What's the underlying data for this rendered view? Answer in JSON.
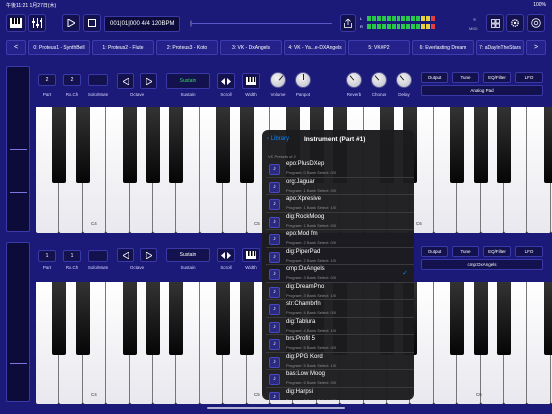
{
  "status": {
    "time": "午後11:21 1月27日(木)",
    "battery": "100%"
  },
  "toolbar": {
    "song_position": "001|01|000  4/4  120BPM",
    "midi_label": "MIDI",
    "meter_left": "L",
    "meter_right": "R"
  },
  "tabs": [
    "0: Proteus1 - SynthBell",
    "1: Proteus2 - Flute",
    "2: Proteus3 - Koto",
    "3: VK - DxAngels",
    "4: VK - Ya...e-DXAngels",
    "5: VK#P2",
    "6: Everlasting Dream",
    "7: aDayInTheStars"
  ],
  "tab_prev": "<",
  "tab_next": ">",
  "parts": [
    {
      "part": "2",
      "rxch": "2",
      "solo": "",
      "labels": {
        "part": "Part",
        "rxch": "Rx.Ch",
        "solo": "Solo/Mute",
        "octave": "Octave",
        "sustain": "Sustain",
        "scroll": "Scroll",
        "width": "Width",
        "volume": "Volume",
        "panpot": "Panpot",
        "reverb": "Reverb",
        "chorus": "Chorus",
        "delay": "Delay"
      },
      "sustain": "Sustain",
      "buttons": [
        "Output",
        "Tune",
        "EQ/Filter",
        "LFO"
      ],
      "preset": "Analog Pad",
      "key_labels": [
        "C4",
        "C5",
        "C6"
      ]
    },
    {
      "part": "1",
      "rxch": "1",
      "solo": "",
      "labels": {
        "part": "Part",
        "rxch": "Rx.Ch",
        "solo": "Solo/Mute",
        "octave": "Octave",
        "sustain": "Sustain",
        "scroll": "Scroll",
        "width": "Width"
      },
      "sustain": "Sustain",
      "buttons": [
        "Output",
        "Tune",
        "EQ/Filter",
        "LFO"
      ],
      "preset": "cmp:DxAngels",
      "key_labels": [
        "C4",
        "C5",
        "C6"
      ]
    }
  ],
  "popover": {
    "back": "Library",
    "title": "Instrument (Part #1)",
    "section": "VK Presets of 2",
    "items": [
      {
        "name": "epo:PlusDXep",
        "sub": "Program: 0  Bank Select: 0/0",
        "checked": false
      },
      {
        "name": "org:Jaguar",
        "sub": "Program: 1  Bank Select: 0/0",
        "checked": false
      },
      {
        "name": "apo:Xpresive",
        "sub": "Program: 1  Bank Select: 1/0",
        "checked": false
      },
      {
        "name": "dig:RockMoog",
        "sub": "Program: 1  Bank Select: 0/0",
        "checked": false
      },
      {
        "name": "epo:Mod fm",
        "sub": "Program: 2  Bank Select: 0/0",
        "checked": false
      },
      {
        "name": "dig:PiperPad",
        "sub": "Program: 2  Bank Select: 1/0",
        "checked": false
      },
      {
        "name": "cmp:DxAngels",
        "sub": "Program: 3  Bank Select: 0/0",
        "checked": true
      },
      {
        "name": "dig:DreamPno",
        "sub": "Program: 3  Bank Select: 1/0",
        "checked": false
      },
      {
        "name": "str:Chambrfn",
        "sub": "Program: 4  Bank Select: 0/0",
        "checked": false
      },
      {
        "name": "dig:Tablura",
        "sub": "Program: 4  Bank Select: 1/0",
        "checked": false
      },
      {
        "name": "brs:Profit 5",
        "sub": "Program: 5  Bank Select: 0/0",
        "checked": false
      },
      {
        "name": "dig:PPG Kord",
        "sub": "Program: 5  Bank Select: 1/0",
        "checked": false
      },
      {
        "name": "bas:Low Moog",
        "sub": "Program: 6  Bank Select: 0/0",
        "checked": false
      },
      {
        "name": "dig:Harpsi",
        "sub": "Program: 6  Bank Select: 1/0",
        "checked": false
      }
    ],
    "check_glyph": "✓",
    "item_glyph": "♪"
  }
}
